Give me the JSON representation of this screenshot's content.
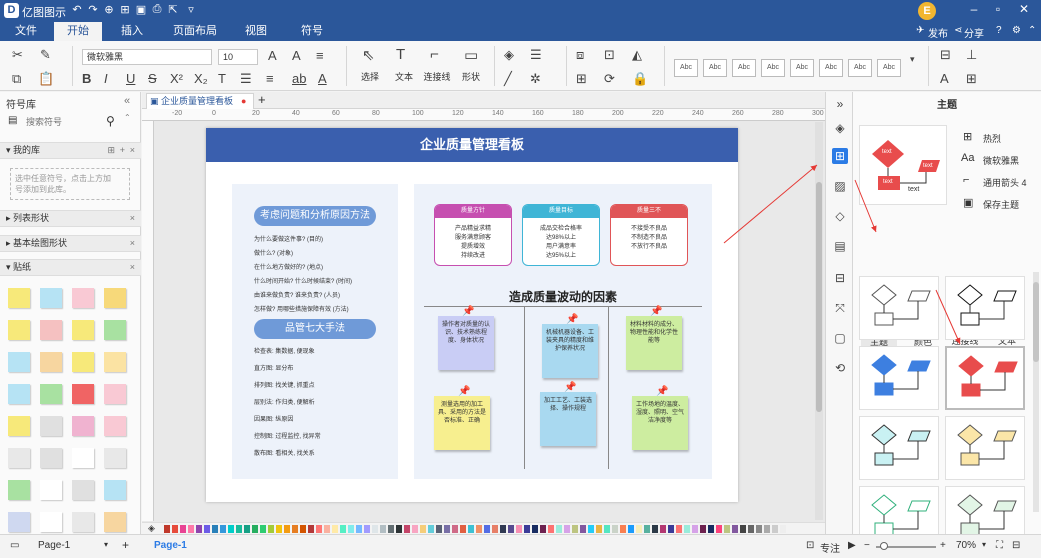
{
  "app": {
    "title": "亿图图示",
    "logo": "D",
    "user_initial": "E"
  },
  "menu": {
    "items": [
      {
        "label": "文件",
        "active": false
      },
      {
        "label": "开始",
        "active": true
      },
      {
        "label": "插入",
        "active": false
      },
      {
        "label": "页面布局",
        "active": false
      },
      {
        "label": "视图",
        "active": false
      },
      {
        "label": "符号",
        "active": false
      }
    ],
    "publish": "发布",
    "share": "分享"
  },
  "toolbar": {
    "font_name": "微软雅黑",
    "font_size": "10",
    "select_label": "选择",
    "text_label": "文本",
    "connector_label": "连接线",
    "shape_label": "形状",
    "style_box": "Abc"
  },
  "left_panel": {
    "title": "符号库",
    "search_placeholder": "搜索符号",
    "my_library": "我的库",
    "empty_hint_1": "选中任意符号，点击上方加",
    "empty_hint_2": "号添加到此库。",
    "section_list": "列表形状",
    "section_basic": "基本绘图形状",
    "section_sticky": "贴纸"
  },
  "canvas": {
    "tab_title": "企业质量管理看板",
    "ruler_ticks": [
      "-20",
      "0",
      "20",
      "40",
      "60",
      "80",
      "100",
      "120",
      "140",
      "160",
      "180",
      "200",
      "220",
      "240",
      "260",
      "280",
      "300"
    ],
    "page_title": "企业质量管理看板",
    "left_pill_1": "考虑问题和分析原因方法",
    "questions": [
      "为什么要做这件事?  (目的)",
      "做什么?  (对象)",
      "在什么地方做好的?  (地点)",
      "什么时间开始? 什么时候结束?  (时间)",
      "由谁来做负责?  谁来负责?  (人员)",
      "怎样做? 用哪些措施保障有效  (方法)"
    ],
    "left_pill_2": "品管七大手法",
    "tools": [
      "检查表: 集数据, 便现象",
      "直方图: 显分布",
      "排列图: 找关键, 抓重点",
      "层别法: 作归类, 便解析",
      "因果图: 纵原因",
      "控制图: 过程监控, 找异常",
      "散布图: 看相关, 找关系"
    ],
    "cards": [
      {
        "title": "质量方针",
        "color": "#c64fb0",
        "lines": [
          "产品精益求精",
          "服务满意顾客",
          "提质增效",
          "持续改进"
        ]
      },
      {
        "title": "质量目标",
        "color": "#3fb5d6",
        "lines": [
          "成品交检合格率",
          "达98%以上",
          "用户满意率",
          "达95%以上"
        ]
      },
      {
        "title": "质量三不",
        "color": "#e05557",
        "lines": [
          "不接受不良品",
          "不制造不良品",
          "不放行不良品"
        ]
      }
    ],
    "factors_title": "造成质量波动的因素",
    "notes": [
      {
        "text": "操作者对质量的认识、技术熟练程度、身体状况",
        "color": "#c9cdf5"
      },
      {
        "text": "机械机器设备、工装夹具的精度和维护保养状况",
        "color": "#a9d9f0"
      },
      {
        "text": "材料材料的成分、物理性能和化学性能等",
        "color": "#cdeda0"
      },
      {
        "text": "测量选用的加工具、采用的方法是否标准、正确",
        "color": "#f7ef8f"
      },
      {
        "text": "加工工艺、工装选择、操作规程",
        "color": "#a9d9f0"
      },
      {
        "text": "工作场地的温度、湿度、照明、空气洁净度等",
        "color": "#cdeda0"
      }
    ]
  },
  "theme_panel": {
    "title": "主题",
    "option_hot": "热烈",
    "option_font": "微软雅黑",
    "option_arrow": "通用箭头 4",
    "option_save": "保存主题",
    "preview_text": "text",
    "tabs": [
      "主题",
      "颜色",
      "连接线",
      "文本"
    ]
  },
  "status": {
    "page_select": "Page-1",
    "page_tab": "Page-1",
    "focus": "专注",
    "zoom": "70%"
  },
  "colors": {
    "brand": "#2b579a",
    "accent": "#2b7be5",
    "header_blue": "#3a5fae",
    "arrow_red": "#e53935"
  }
}
